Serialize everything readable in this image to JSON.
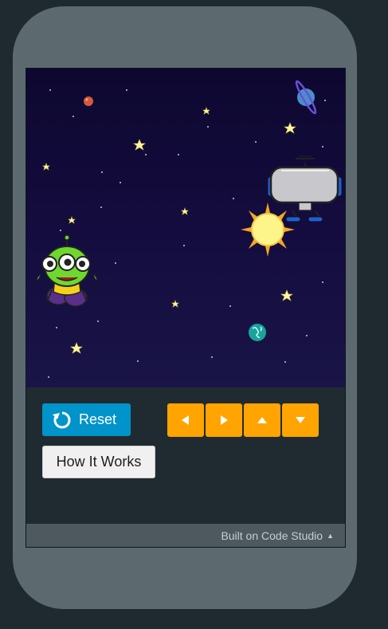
{
  "colors": {
    "reset_button": "#0094ca",
    "arrow_buttons": "#ffa400",
    "stage_background": "#140c3e",
    "phone_frame": "#5c6a70"
  },
  "controls": {
    "reset_label": "Reset",
    "how_it_works_label": "How It Works",
    "arrows": [
      {
        "name": "left-arrow-icon",
        "direction": "left"
      },
      {
        "name": "right-arrow-icon",
        "direction": "right"
      },
      {
        "name": "up-arrow-icon",
        "direction": "up"
      },
      {
        "name": "down-arrow-icon",
        "direction": "down"
      }
    ]
  },
  "footer": {
    "label": "Built on Code Studio",
    "caret": "▲"
  },
  "stage": {
    "sprites": [
      "alien-character",
      "robot-spaceship",
      "sun",
      "ringed-planet",
      "earth-planet",
      "mars-planet",
      "stars"
    ]
  }
}
